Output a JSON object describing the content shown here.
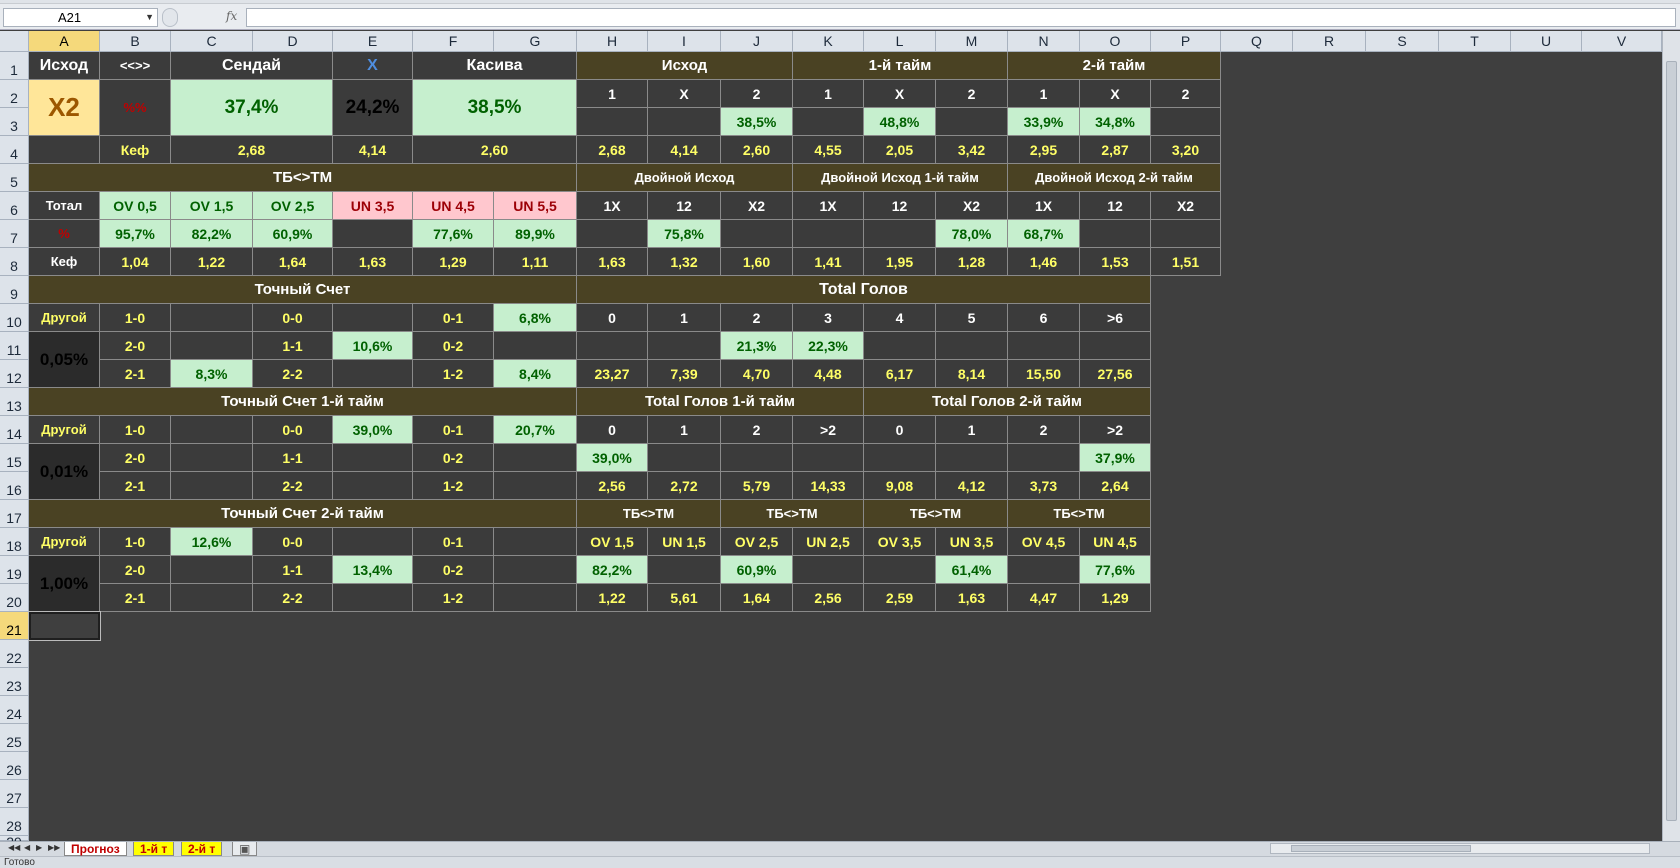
{
  "formula_bar": {
    "name_box": "A21",
    "fx_label": "fx",
    "value": ""
  },
  "columns": [
    "A",
    "B",
    "C",
    "D",
    "E",
    "F",
    "G",
    "H",
    "I",
    "J",
    "K",
    "L",
    "M",
    "N",
    "O",
    "P",
    "Q",
    "R",
    "S",
    "T",
    "U",
    "V"
  ],
  "rows": [
    "1",
    "2",
    "3",
    "4",
    "5",
    "6",
    "7",
    "8",
    "9",
    "10",
    "11",
    "12",
    "13",
    "14",
    "15",
    "16",
    "17",
    "18",
    "19",
    "20",
    "21",
    "22",
    "23",
    "24",
    "25",
    "26",
    "27",
    "28",
    "29"
  ],
  "outcome": {
    "header": "Исход",
    "arrows": "<<>>",
    "home": "Сендай",
    "draw": "X",
    "away": "Касива",
    "pick": "X2",
    "pct_label": "%%",
    "home_pct": "37,4%",
    "draw_pct": "24,2%",
    "away_pct": "38,5%",
    "kef_label": "Кеф",
    "home_kef": "2,68",
    "draw_kef": "4,14",
    "away_kef": "2,60"
  },
  "markets": {
    "h_full": "Исход",
    "h_first": "1-й тайм",
    "h_second": "2-й тайм",
    "labels": [
      "1",
      "X",
      "2",
      "1",
      "X",
      "2",
      "1",
      "X",
      "2"
    ],
    "pct": [
      "",
      "",
      "38,5%",
      "",
      "48,8%",
      "",
      "33,9%",
      "34,8%",
      ""
    ],
    "kef": [
      "2,68",
      "4,14",
      "2,60",
      "4,55",
      "2,05",
      "3,42",
      "2,95",
      "2,87",
      "3,20"
    ],
    "h_dbl": "Двойной Исход",
    "h_dbl1": "Двойной Исход 1-й тайм",
    "h_dbl2": "Двойной Исход 2-й тайм",
    "dbl_labels": [
      "1X",
      "12",
      "X2",
      "1X",
      "12",
      "X2",
      "1X",
      "12",
      "X2"
    ],
    "dbl_pct": [
      "",
      "75,8%",
      "",
      "",
      "",
      "78,0%",
      "68,7%",
      "",
      ""
    ],
    "dbl_kef": [
      "1,63",
      "1,32",
      "1,60",
      "1,41",
      "1,95",
      "1,28",
      "1,46",
      "1,53",
      "1,51"
    ]
  },
  "totals": {
    "header": "ТБ<>ТМ",
    "total_label": "Тотал",
    "pct_label": "%",
    "kef_label": "Кеф",
    "labels": [
      "OV 0,5",
      "OV 1,5",
      "OV 2,5",
      "UN 3,5",
      "UN 4,5",
      "UN 5,5"
    ],
    "pct": [
      "95,7%",
      "82,2%",
      "60,9%",
      "",
      "77,6%",
      "89,9%"
    ],
    "kef": [
      "1,04",
      "1,22",
      "1,64",
      "1,63",
      "1,29",
      "1,11"
    ]
  },
  "score": {
    "header": "Точный Счет",
    "other": "Другой",
    "other_pct": "0,05%",
    "r1": [
      "1-0",
      "",
      "0-0",
      "",
      "0-1",
      "6,8%"
    ],
    "r2": [
      "2-0",
      "",
      "1-1",
      "10,6%",
      "0-2",
      ""
    ],
    "r3": [
      "2-1",
      "8,3%",
      "2-2",
      "",
      "1-2",
      "8,4%"
    ]
  },
  "goals": {
    "header": "Total Голов",
    "labels": [
      "0",
      "1",
      "2",
      "3",
      "4",
      "5",
      "6",
      ">6"
    ],
    "pct": [
      "",
      "",
      "21,3%",
      "22,3%",
      "",
      "",
      "",
      ""
    ],
    "kef": [
      "23,27",
      "7,39",
      "4,70",
      "4,48",
      "6,17",
      "8,14",
      "15,50",
      "27,56"
    ]
  },
  "score1": {
    "header": "Точный Счет 1-й тайм",
    "other": "Другой",
    "other_pct": "0,01%",
    "r1": [
      "1-0",
      "",
      "0-0",
      "39,0%",
      "0-1",
      "20,7%"
    ],
    "r2": [
      "2-0",
      "",
      "1-1",
      "",
      "0-2",
      ""
    ],
    "r3": [
      "2-1",
      "",
      "2-2",
      "",
      "1-2",
      ""
    ]
  },
  "goals12": {
    "h1": "Total Голов 1-й тайм",
    "h2": "Total Голов 2-й тайм",
    "labels": [
      "0",
      "1",
      "2",
      ">2",
      "0",
      "1",
      "2",
      ">2"
    ],
    "pct": [
      "39,0%",
      "",
      "",
      "",
      "",
      "",
      "",
      "37,9%"
    ],
    "kef": [
      "2,56",
      "2,72",
      "5,79",
      "14,33",
      "9,08",
      "4,12",
      "3,73",
      "2,64"
    ]
  },
  "score2": {
    "header": "Точный Счет 2-й тайм",
    "other": "Другой",
    "other_pct": "1,00%",
    "r1": [
      "1-0",
      "12,6%",
      "0-0",
      "",
      "0-1",
      ""
    ],
    "r2": [
      "2-0",
      "",
      "1-1",
      "13,4%",
      "0-2",
      ""
    ],
    "r3": [
      "2-1",
      "",
      "2-2",
      "",
      "1-2",
      ""
    ]
  },
  "tbtm": {
    "header": "ТБ<>ТМ",
    "labels": [
      "OV 1,5",
      "UN 1,5",
      "OV 2,5",
      "UN 2,5",
      "OV 3,5",
      "UN 3,5",
      "OV 4,5",
      "UN 4,5"
    ],
    "pct": [
      "82,2%",
      "",
      "60,9%",
      "",
      "",
      "61,4%",
      "",
      "77,6%"
    ],
    "kef": [
      "1,22",
      "5,61",
      "1,64",
      "2,56",
      "2,59",
      "1,63",
      "4,47",
      "1,29"
    ]
  },
  "sheets": [
    "Прогноз",
    "1-й т",
    "2-й т"
  ],
  "status": "Готово"
}
